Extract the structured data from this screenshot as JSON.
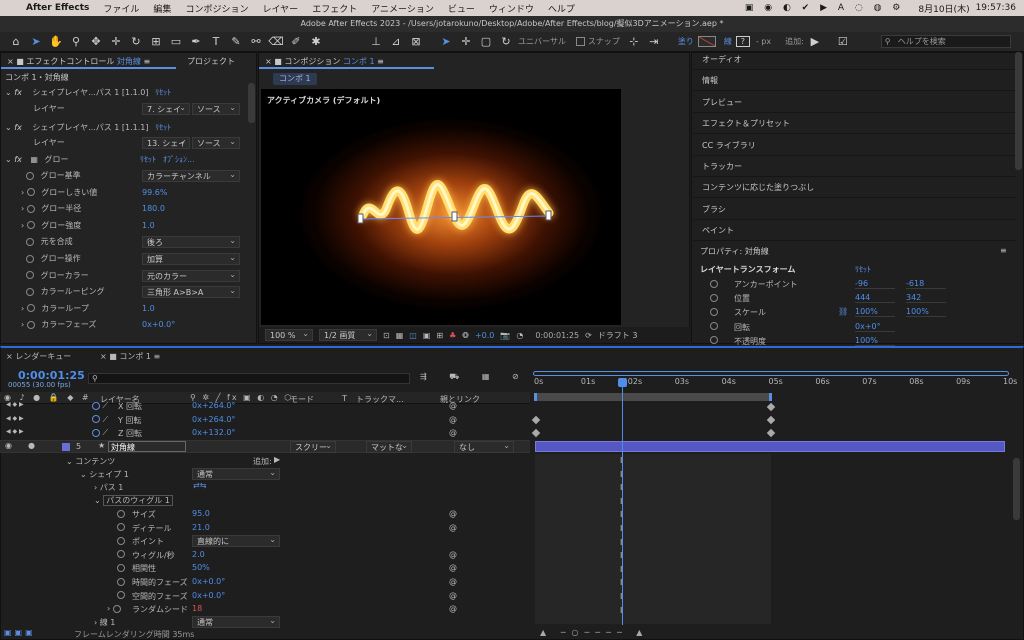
{
  "menubar": {
    "app": "After Effects",
    "items": [
      "ファイル",
      "編集",
      "コンポジション",
      "レイヤー",
      "エフェクト",
      "アニメーション",
      "ビュー",
      "ウィンドウ",
      "ヘルプ"
    ],
    "date": "8月10日(木)",
    "time": "19:57:36"
  },
  "titlebar": {
    "title": "Adobe After Effects 2023 - /Users/jotarokuno/Desktop/Adobe/After Effects/blog/擬似3Dアニメーション.aep *"
  },
  "toolbar": {
    "universal": "ユニバーサル",
    "snap": "スナップ",
    "fill": "塗り",
    "stroke": "線",
    "px": "- px",
    "add": "追加:",
    "help_search": "ヘルプを検索"
  },
  "effects_panel": {
    "tab": "エフェクトコントロール",
    "tab_layer": "対角線",
    "tab2": "プロジェクト",
    "header": "コンポ 1・対角線",
    "reset": "ﾘｾｯﾄ",
    "options": "ｵﾌﾟｼｮﾝ...",
    "fx1": {
      "name": "シェイプレイヤ...パス 1 [1.1.0]",
      "layer_label": "レイヤー",
      "layer_val": "7. シェイ",
      "src": "ソース"
    },
    "fx2": {
      "name": "シェイプレイヤ...パス 1 [1.1.1]",
      "layer_label": "レイヤー",
      "layer_val": "13. シェイ",
      "src": "ソース"
    },
    "glow": {
      "name": "グロー"
    },
    "params": [
      {
        "label": "グロー基準",
        "value": "カラーチャンネル",
        "type": "dd"
      },
      {
        "label": "グローしきい値",
        "value": "99.6%",
        "type": "val"
      },
      {
        "label": "グロー半径",
        "value": "180.0",
        "type": "val"
      },
      {
        "label": "グロー強度",
        "value": "1.0",
        "type": "val"
      },
      {
        "label": "元を合成",
        "value": "後ろ",
        "type": "dd"
      },
      {
        "label": "グロー操作",
        "value": "加算",
        "type": "dd"
      },
      {
        "label": "グローカラー",
        "value": "元のカラー",
        "type": "dd"
      },
      {
        "label": "カラールーピング",
        "value": "三角形 A>B>A",
        "type": "dd"
      },
      {
        "label": "カラーループ",
        "value": "1.0",
        "type": "val"
      },
      {
        "label": "カラーフェーズ",
        "value": "0x+0.0°",
        "type": "val"
      }
    ]
  },
  "comp_panel": {
    "tab": "コンポジション",
    "tab_name": "コンポ 1",
    "subtab": "コンポ 1",
    "camera": "アクティブカメラ (デフォルト)",
    "zoom": "100 %",
    "quality": "1/2 画質",
    "exposure": "+0.0",
    "timecode": "0:00:01:25",
    "draft": "ドラフト 3"
  },
  "right_panel": {
    "items": [
      "オーディオ",
      "情報",
      "プレビュー",
      "エフェクト＆プリセット",
      "CC ライブラリ",
      "トラッカー",
      "コンテンツに応じた塗りつぶし",
      "ブラシ",
      "ペイント"
    ],
    "props_title": "プロパティ: 対角線",
    "layer_transform": "レイヤートランスフォーム",
    "reset": "ﾘｾｯﾄ",
    "props": [
      {
        "label": "アンカーポイント",
        "v1": "-96",
        "v2": "-618"
      },
      {
        "label": "位置",
        "v1": "444",
        "v2": "342"
      },
      {
        "label": "スケール",
        "v1": "100%",
        "v2": "100%"
      },
      {
        "label": "回転",
        "v1": "0x+0°",
        "v2": ""
      },
      {
        "label": "不透明度",
        "v1": "100%",
        "v2": ""
      }
    ]
  },
  "timeline": {
    "tab_render": "レンダーキュー",
    "tab_comp": "コンポ 1",
    "timecode": "0:00:01:25",
    "frames": "00055 (30.00 fps)",
    "search_placeholder": "",
    "col_layer_name": "レイヤー名",
    "col_mode": "モード",
    "col_t": "T",
    "col_trackmat": "トラックマ...",
    "col_parent": "親とリンク",
    "ruler": [
      "0s",
      "01s",
      "02s",
      "03s",
      "04s",
      "05s",
      "06s",
      "07s",
      "08s",
      "09s",
      "10s"
    ],
    "rows_top": [
      {
        "label": "X 回転",
        "value": "0x+264.0°"
      },
      {
        "label": "Y 回転",
        "value": "0x+264.0°"
      },
      {
        "label": "Z 回転",
        "value": "0x+132.0°"
      }
    ],
    "layer": {
      "num": "5",
      "name": "対角線",
      "mode": "スクリー",
      "matte": "マットな",
      "parent": "なし"
    },
    "contents": "コンテンツ",
    "add": "追加:",
    "shape1": "シェイプ 1",
    "shape1_mode": "通常",
    "path1": "パス 1",
    "wiggle": "パスのウィグル 1",
    "wiggle_params": [
      {
        "label": "サイズ",
        "value": "95.0"
      },
      {
        "label": "ディテール",
        "value": "21.0"
      },
      {
        "label": "ポイント",
        "value": "直線的に",
        "type": "dd"
      },
      {
        "label": "ウィグル/秒",
        "value": "2.0"
      },
      {
        "label": "相関性",
        "value": "50%"
      },
      {
        "label": "時間的フェーズ",
        "value": "0x+0.0°"
      },
      {
        "label": "空間的フェーズ",
        "value": "0x+0.0°"
      },
      {
        "label": "ランダムシード",
        "value": "18",
        "red": true
      }
    ],
    "line1": "線 1",
    "line1_mode": "通常",
    "footer": "フレームレンダリング時間",
    "footer_val": "35ms"
  }
}
